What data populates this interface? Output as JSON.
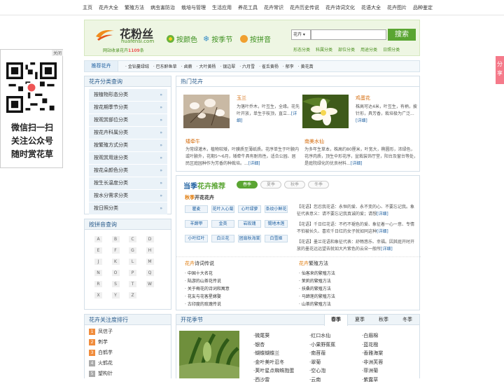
{
  "topnav": [
    "主页",
    "花卉大全",
    "繁殖方法",
    "病虫害防治",
    "栽培与管理",
    "生活应用",
    "养花工具",
    "花卉常识",
    "花卉历史传说",
    "花卉诗词文化",
    "花语大全",
    "花卉图片",
    "品种鉴定"
  ],
  "header": {
    "logo_cn": "花粉丝",
    "logo_en": "huafensi.com",
    "tag_prefix": "网站收录花卉",
    "tag_count": "1109",
    "tag_suffix": "条",
    "nav_color": "按颜色",
    "nav_season": "按季节",
    "nav_pinyin": "按拼音",
    "search_select": "花卉 ▾",
    "search_btn": "搜索",
    "search_links": [
      "形态分类",
      "科属分类",
      "部位分类",
      "用途分类",
      "日照分类"
    ]
  },
  "recommend": {
    "title": "推荐花卉",
    "items": [
      "金钻蔓绿绒",
      "巴东醉鱼草",
      "卤蕨",
      "大叶黄杨",
      "银边翠",
      "六月雪",
      "雀舌黄杨",
      "郁李",
      "黄花蒿"
    ]
  },
  "leftad": {
    "close": "关闭",
    "lines": [
      "微信扫一扫",
      "关注公众号",
      "随时赏花草"
    ]
  },
  "share": "分享",
  "category": {
    "title": "花卉分类查询",
    "items": [
      "按植物形态分类",
      "按花期季节分类",
      "按观赏部位分类",
      "按花卉科属分类",
      "按繁殖方式分类",
      "按观赏用途分类",
      "按花朵颜色分类",
      "按生长温度分类",
      "按水分需求分类",
      "按日照分类"
    ]
  },
  "pinyin": {
    "title": "按拼音查询",
    "letters": [
      "A",
      "B",
      "C",
      "D",
      "E",
      "F",
      "G",
      "H",
      "J",
      "K",
      "L",
      "M",
      "N",
      "O",
      "P",
      "Q",
      "R",
      "S",
      "T",
      "W",
      "X",
      "Y",
      "Z"
    ]
  },
  "ranking": {
    "title": "花卉关注度排行",
    "items": [
      "凤信子",
      "刺芋",
      "白鹤芋",
      "火鹤花",
      "望构针"
    ]
  },
  "hot": {
    "title": "热门花卉",
    "items": [
      {
        "name": "玉兰",
        "desc": "为落叶乔木，叶互生，全缘。花先叶开放，单生于枝顶，直立...",
        "more": "[详细]"
      },
      {
        "name": "鸡蛋花",
        "desc": "株高可达4米，叶互生，有柄，披针形，具芳香，栽培极为广泛...",
        "more": "[详细]"
      },
      {
        "name": "矮牵牛",
        "desc": "为常绿灌木，植物较矮，叶膜质至薄纸质。花序单生于叶腋内或叶腋外，花期5〜6月，矮牵牛具有耐热性。适合公园、居民区庭园种作为芳香的种栽培。...",
        "more": "[详细]"
      },
      {
        "name": "南美水仙",
        "desc": "为多年生草本，株高约80厘米，叶宽大，椭圆形，浓绿色，花序肉质，顶生伞形花序，盆栽装饰厅堂，阳台及窗台等处，是庭院绿化的优良材料...",
        "more": "[详细]"
      }
    ]
  },
  "season": {
    "title_a": "当季",
    "title_b": "花卉推荐",
    "sub_a": "秋季",
    "sub_b": "开花花卉",
    "tabs": [
      "春季",
      "夏季",
      "秋季",
      "冬季"
    ],
    "flowers": [
      "瞿麦",
      "花叶入心菊",
      "心叶绿萝",
      "条纹小鲜花",
      "羊蹄甲",
      "金英",
      "岩玫瑰",
      "锡地木莲",
      "小叶红叶",
      "白兰花",
      "团扇秋海棠",
      "白雪姬"
    ],
    "quotes": [
      {
        "text": "【花语】您忍我花语：永恒的爱、永不变的心、不要忘记我。象征代表意义：请不要忘记我真诚的爱；请想",
        "more": "[详细]"
      },
      {
        "text": "【花语】千日红花语：不朽不褪色的爱、象征着一心一意、专情不怕被长久、喜欢千日红的女子就如同这种",
        "more": "[详细]"
      },
      {
        "text": "【花语】墨兰花语和象征代表：舒畅悠乐、幸福。因其庭开时开放的墨花远远望去就如大片紫色的云朵一般所",
        "more": "[详细]"
      }
    ]
  },
  "poem": {
    "title_a": "花卉",
    "title_b": "诗词传说",
    "items": [
      "中国十大名花",
      "陆游的山茶花传说",
      "关于梅花的诗词和寓意",
      "花友与花客星嫁娶",
      "古印度的玫瑰传说"
    ]
  },
  "breed": {
    "title_a": "花卉",
    "title_b": "繁殖方法",
    "items": [
      "仙客来的繁殖方法",
      "茉莉的繁殖方法",
      "扶桑的繁殖方法",
      "马蹄莲的繁殖方法",
      "山茶的繁殖方法"
    ]
  },
  "flseason": {
    "title": "开花季节",
    "tabs": [
      "春季",
      "夏季",
      "秋季",
      "冬季"
    ],
    "col1": [
      "·微尾葵",
      "·银杏",
      "·蝴蝶蝴蝶兰",
      "·金叶美叶忍冬",
      "·荚叶星点蜘蛛抱蛋",
      "·西沙雷"
    ],
    "col2": [
      "·红口水仙",
      "·小果野蕉蕉",
      "·南苜蓿",
      "·翠菊",
      "·空心泡",
      "·云南"
    ],
    "col3": [
      "·白眉棉",
      "·蓝花楹",
      "·香雅海棠",
      "·非洲芙蓉",
      "·菲洲菊",
      "·紫露草"
    ]
  }
}
